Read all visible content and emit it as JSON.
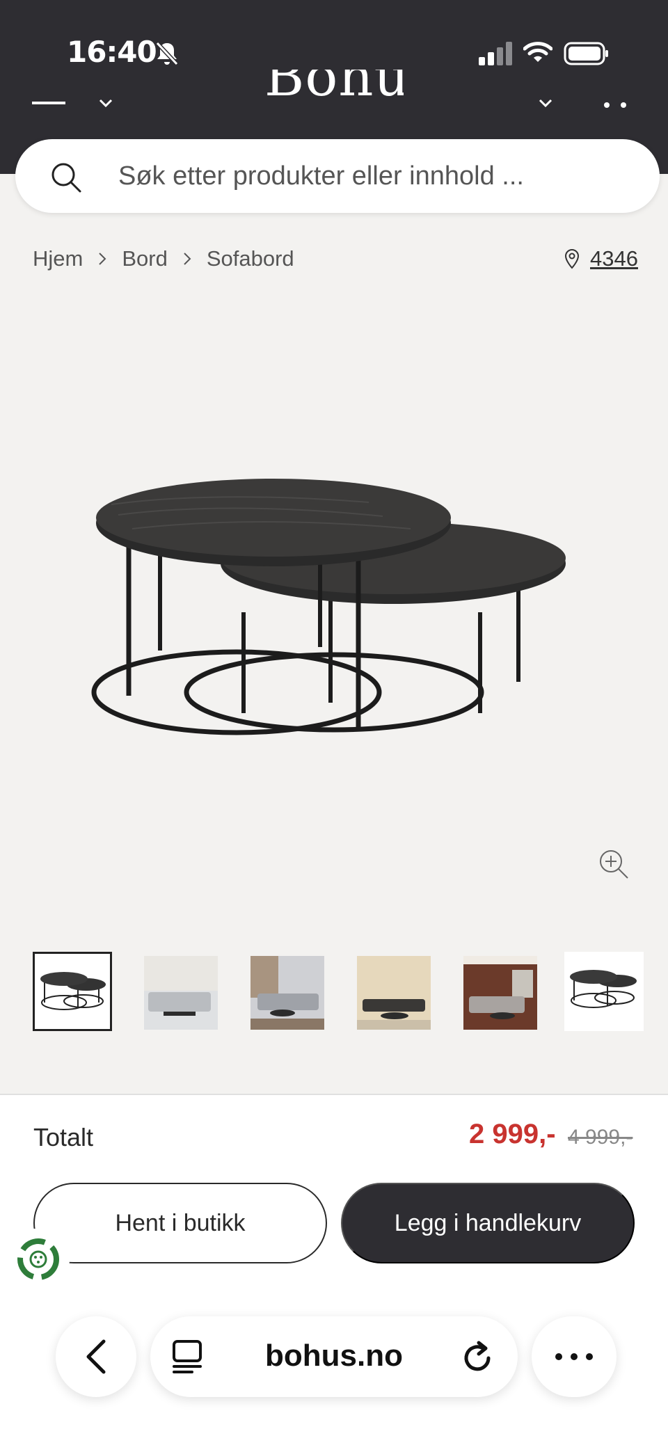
{
  "status_bar": {
    "time": "16:40",
    "icons": [
      "bell-slash-icon",
      "signal-icon",
      "wifi-icon",
      "battery-icon"
    ]
  },
  "header": {
    "logo": "Bohus",
    "icons": [
      "menu-icon",
      "chevron-down-icon",
      "chevron-down-icon",
      "more-icon"
    ]
  },
  "search": {
    "placeholder": "Søk etter produkter eller innhold ..."
  },
  "breadcrumb": {
    "items": [
      "Hjem",
      "Bord",
      "Sofabord"
    ]
  },
  "store": {
    "code": "4346",
    "icon": "location-pin-icon"
  },
  "gallery": {
    "selected_index": 0,
    "thumbnail_count": 6,
    "zoom_icon": "zoom-in-icon"
  },
  "checkout": {
    "total_label": "Totalt",
    "price": "2 999,-",
    "old_price": "4 999,-",
    "pickup_label": "Hent i butikk",
    "cart_label": "Legg i handlekurv"
  },
  "browser": {
    "domain": "bohus.no",
    "icons": [
      "back-icon",
      "reader-icon",
      "reload-icon",
      "more-icon"
    ]
  },
  "colors": {
    "header_bg": "#2e2d32",
    "page_bg": "#f3f2f0",
    "price_red": "#c8332f",
    "button_dark": "#2e2d32"
  }
}
